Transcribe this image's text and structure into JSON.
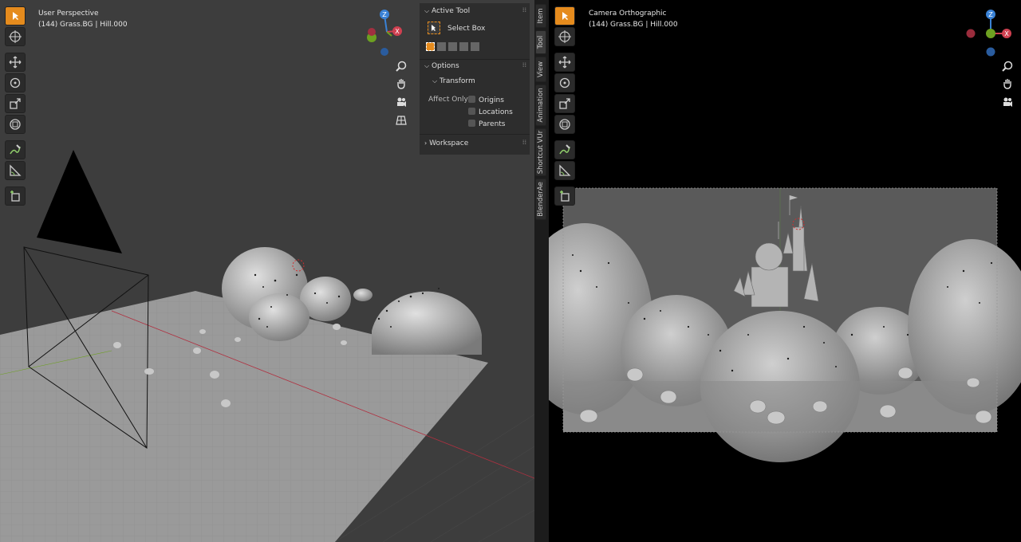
{
  "left_viewport": {
    "title": "User Perspective",
    "subtitle": "(144) Grass.BG | Hill.000"
  },
  "right_viewport": {
    "title": "Camera Orthographic",
    "subtitle": "(144) Grass.BG | Hill.000"
  },
  "gizmo": {
    "z": "Z",
    "x": "X"
  },
  "npanel": {
    "active_tool_header": "Active Tool",
    "select_box_label": "Select Box",
    "options_header": "Options",
    "transform_header": "Transform",
    "affect_only_label": "Affect Only",
    "origins_label": "Origins",
    "locations_label": "Locations",
    "parents_label": "Parents",
    "workspace_header": "Workspace"
  },
  "tabs": [
    "Item",
    "Tool",
    "View",
    "Animation",
    "Shortcut VUr",
    "BlenderAe"
  ],
  "colors": {
    "accent": "#e58b1d",
    "axis_x": "#d04050",
    "axis_y": "#6da021",
    "axis_z": "#3a82d6"
  }
}
